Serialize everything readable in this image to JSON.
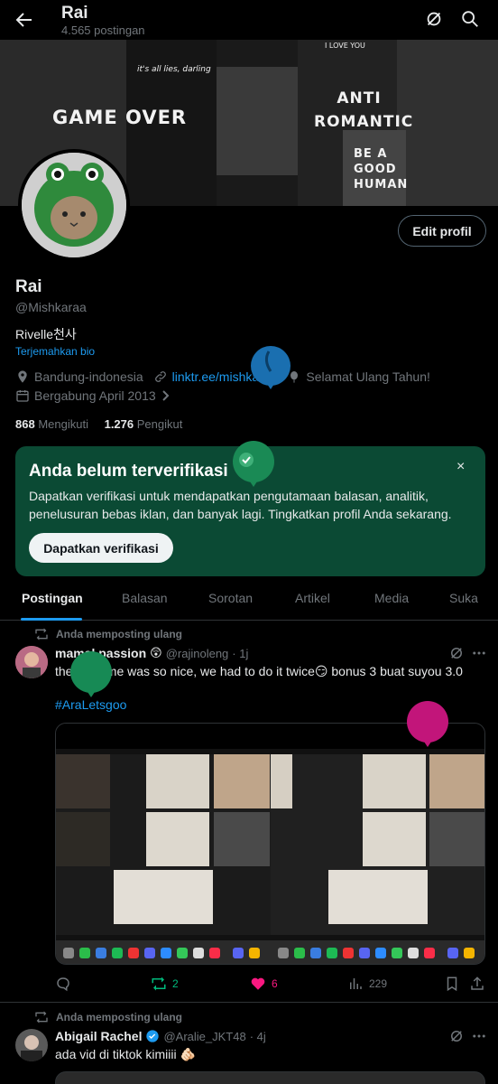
{
  "header": {
    "title": "Rai",
    "post_count": "4.565 postingan"
  },
  "banner": {
    "texts": [
      "GAME OVER",
      "ANTI ROMANTIC",
      "BE A GOOD HUMAN",
      "it's all lies, darling",
      "I LOVE YOU"
    ]
  },
  "profile": {
    "edit_label": "Edit profil",
    "name": "Rai",
    "handle": "@Mishkaraa",
    "bio": "Rivelle천사",
    "translate": "Terjemahkan bio",
    "location": "Bandung-indonesia",
    "link": "linktr.ee/mishkaraa",
    "birthday": "Selamat Ulang Tahun!",
    "joined": "Bergabung April 2013",
    "following_count": "868",
    "following_label": "Mengikuti",
    "followers_count": "1.276",
    "followers_label": "Pengikut"
  },
  "verify_card": {
    "title": "Anda belum terverifikasi",
    "description": "Dapatkan verifikasi untuk mendapatkan pengutamaan balasan, analitik, penelusuran bebas iklan, dan banyak lagi. Tingkatkan profil Anda sekarang.",
    "button": "Dapatkan verifikasi",
    "close": "×"
  },
  "tabs": [
    "Postingan",
    "Balasan",
    "Sorotan",
    "Artikel",
    "Media",
    "Suka"
  ],
  "posts": [
    {
      "repost_label": "Anda memposting ulang",
      "name": "mamal passion",
      "emoji": "😲",
      "handle": "@rajinoleng",
      "time": "· 1j",
      "text": "the first time was so nice, we had to do it twice😏 bonus 3 buat suyou 3.0",
      "hashtag": "#AraLetsgoo",
      "replies": "",
      "reposts": "2",
      "likes": "6",
      "views": "229"
    },
    {
      "repost_label": "Anda memposting ulang",
      "name": "Abigail Rachel",
      "handle": "@Aralie_JKT48",
      "time": "· 4j",
      "text": "ada vid di tiktok kimiiii 🫵🏻"
    }
  ],
  "colors": {
    "accent": "#1d9bf0",
    "verify_bg": "#0b4a34",
    "repost_green": "#00ba7c",
    "like_pink": "#f91880"
  }
}
